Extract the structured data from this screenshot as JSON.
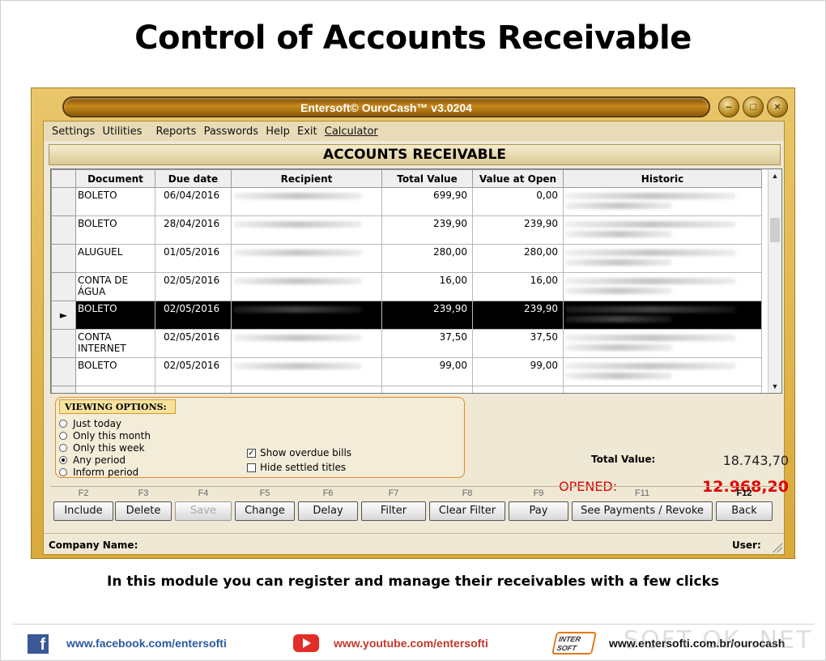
{
  "page": {
    "title": "Control of Accounts Receivable",
    "caption": "In this module you can register and manage their receivables with a few clicks"
  },
  "window": {
    "title": "Entersoft© OuroCash™ v3.0204"
  },
  "menu": [
    "Settings",
    "Utilities",
    "Reports",
    "Passwords",
    "Help",
    "Exit",
    "Calculator"
  ],
  "section_title": "ACCOUNTS RECEIVABLE",
  "table": {
    "columns": [
      "Document",
      "Due date",
      "Recipient",
      "Total Value",
      "Value at Open",
      "Historic"
    ],
    "rows": [
      {
        "document": "BOLETO",
        "due_date": "06/04/2016",
        "total": "699,90",
        "open": "0,00"
      },
      {
        "document": "BOLETO",
        "due_date": "28/04/2016",
        "total": "239,90",
        "open": "239,90"
      },
      {
        "document": "ALUGUEL",
        "due_date": "01/05/2016",
        "total": "280,00",
        "open": "280,00"
      },
      {
        "document": "CONTA DE ÁGUA",
        "due_date": "02/05/2016",
        "total": "16,00",
        "open": "16,00"
      },
      {
        "document": "BOLETO",
        "due_date": "02/05/2016",
        "total": "239,90",
        "open": "239,90",
        "selected": true
      },
      {
        "document": "CONTA INTERNET",
        "due_date": "02/05/2016",
        "total": "37,50",
        "open": "37,50"
      },
      {
        "document": "BOLETO",
        "due_date": "02/05/2016",
        "total": "99,00",
        "open": "99,00"
      }
    ]
  },
  "viewing_options": {
    "title": "VIEWING OPTIONS:",
    "radios": [
      {
        "label": "Just today",
        "checked": false
      },
      {
        "label": "Only this month",
        "checked": false
      },
      {
        "label": "Only this week",
        "checked": false
      },
      {
        "label": "Any period",
        "checked": true
      },
      {
        "label": "Inform period",
        "checked": false
      }
    ],
    "checks": [
      {
        "label": "Show overdue bills",
        "checked": true
      },
      {
        "label": "Hide settled titles",
        "checked": false
      }
    ]
  },
  "totals": {
    "total_label": "Total Value:",
    "total_value": "18.743,70",
    "opened_label": "OPENED:",
    "opened_value": "12.968,20",
    "opened_color": "#e00000"
  },
  "function_keys": [
    {
      "key": "F2",
      "label": "Include"
    },
    {
      "key": "F3",
      "label": "Delete"
    },
    {
      "key": "F4",
      "label": "Save",
      "disabled": true
    },
    {
      "key": "F5",
      "label": "Change"
    },
    {
      "key": "F6",
      "label": "Delay"
    },
    {
      "key": "F7",
      "label": "Filter"
    },
    {
      "key": "F8",
      "label": "Clear Filter"
    },
    {
      "key": "F9",
      "label": "Pay"
    },
    {
      "key": "F11",
      "label": "See Payments / Revoke"
    },
    {
      "key": "F12",
      "label": "Back"
    }
  ],
  "status": {
    "company": "Company Name:",
    "user": "User:"
  },
  "footer": {
    "facebook_icon": "f",
    "facebook": "www.facebook.com/entersofti",
    "youtube": "www.youtube.com/entersofti",
    "logo": "INTER SOFT",
    "website": "www.entersofti.com.br/ourocash",
    "watermark": "SOFT OK .NET"
  }
}
